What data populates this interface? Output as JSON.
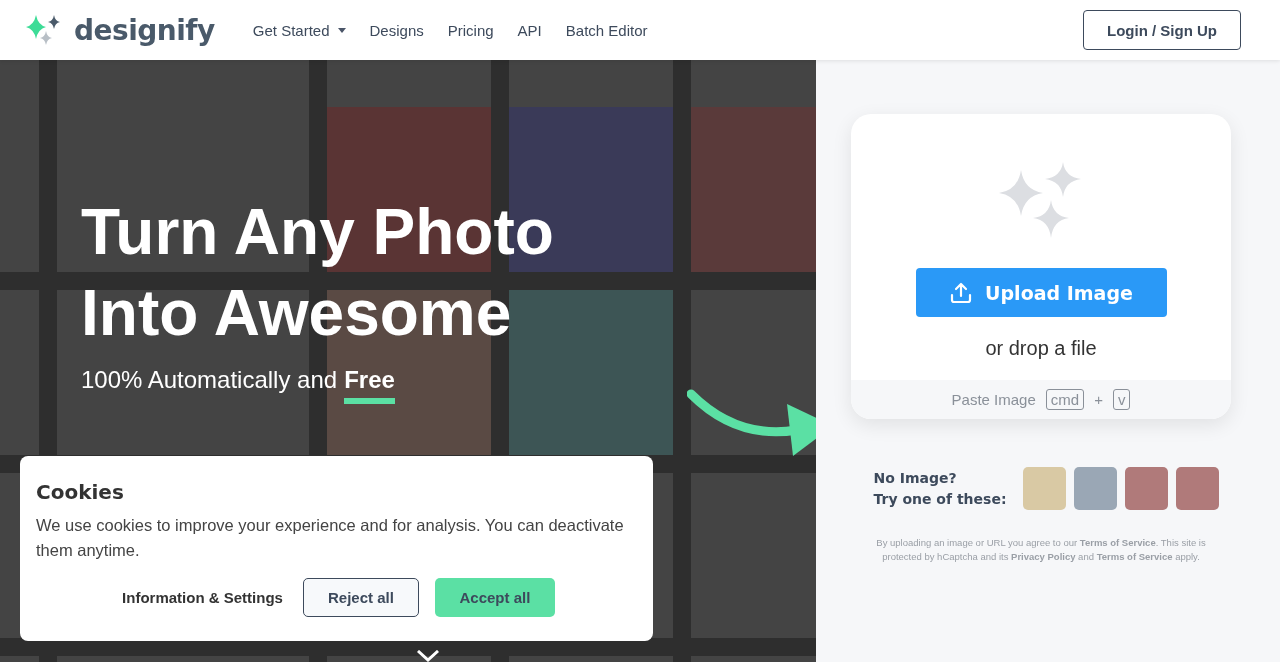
{
  "header": {
    "logo": "designify",
    "nav": [
      {
        "label": "Get Started",
        "dropdown": true
      },
      {
        "label": "Designs",
        "dropdown": false
      },
      {
        "label": "Pricing",
        "dropdown": false
      },
      {
        "label": "API",
        "dropdown": false
      },
      {
        "label": "Batch Editor",
        "dropdown": false
      }
    ],
    "login": "Login / Sign Up"
  },
  "hero": {
    "title_lines": [
      "Turn Any Photo",
      "Into Awesome"
    ],
    "subtitle": "100% Automatically and",
    "highlight": "Free"
  },
  "upload": {
    "button": "Upload Image",
    "drop": "or drop a file",
    "paste": "Paste Image",
    "keys": [
      "cmd",
      "v"
    ],
    "plus": "+"
  },
  "samples": {
    "heading": [
      "No Image?",
      "Try one of these:"
    ],
    "thumbnails": [
      {
        "kind": "product"
      },
      {
        "kind": "car"
      },
      {
        "kind": "portrait"
      },
      {
        "kind": "portrait"
      }
    ]
  },
  "legal": "By uploading an image or URL you agree to our **Terms of Service**. This site is protected by hCaptcha and its **Privacy Policy** and **Terms of Service** apply.",
  "cookies": {
    "title": "Cookies",
    "text": "We use cookies to improve your experience and for analysis. You can deactivate them anytime.",
    "buttons": [
      {
        "label": "Information & Settings",
        "kind": "link"
      },
      {
        "label": "Reject all",
        "kind": "outline"
      },
      {
        "label": "Accept all",
        "kind": "primary"
      }
    ]
  }
}
